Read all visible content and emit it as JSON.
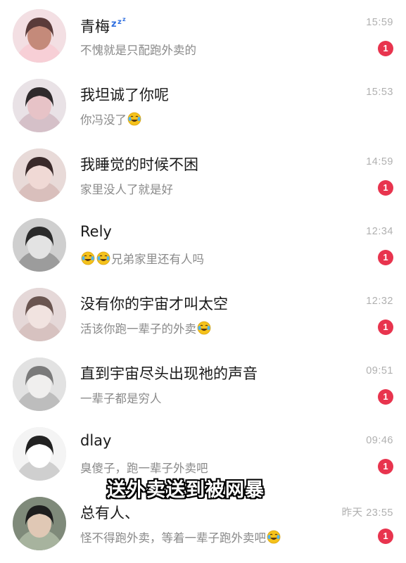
{
  "chats": [
    {
      "name": "青梅",
      "name_suffix_icon": "sleeping-zzz-icon",
      "preview": "不愧就是只配跑外卖的",
      "preview_emoji_prefix": 0,
      "preview_emoji_suffix": 0,
      "time": "15:59",
      "badge": "1"
    },
    {
      "name": "我坦诚了你呢",
      "preview": "你冯没了",
      "preview_emoji_prefix": 0,
      "preview_emoji_suffix": 1,
      "time": "15:53",
      "badge": ""
    },
    {
      "name": "我睡觉的时候不困",
      "preview": "家里没人了就是好",
      "preview_emoji_prefix": 0,
      "preview_emoji_suffix": 0,
      "time": "14:59",
      "badge": "1"
    },
    {
      "name": "Rely",
      "preview": "兄弟家里还有人吗",
      "preview_emoji_prefix": 2,
      "preview_emoji_suffix": 0,
      "time": "12:34",
      "badge": "1"
    },
    {
      "name": "没有你的宇宙才叫太空",
      "preview": "活该你跑一辈子的外卖",
      "preview_emoji_prefix": 0,
      "preview_emoji_suffix": 1,
      "time": "12:32",
      "badge": "1"
    },
    {
      "name": "直到宇宙尽头出现祂的声音",
      "preview": "一辈子都是穷人",
      "preview_emoji_prefix": 0,
      "preview_emoji_suffix": 0,
      "time": "09:51",
      "badge": "1"
    },
    {
      "name": "dlay",
      "preview": "臭傻子，跑一辈子外卖吧",
      "preview_emoji_prefix": 0,
      "preview_emoji_suffix": 0,
      "time": "09:46",
      "badge": "1"
    },
    {
      "name": "总有人、",
      "preview": "怪不得跑外卖，等着一辈子跑外卖吧",
      "preview_emoji_prefix": 0,
      "preview_emoji_suffix": 1,
      "time": "昨天 23:55",
      "badge": "1"
    }
  ],
  "caption": "送外卖送到被网暴",
  "colors": {
    "badge": "#e8344e",
    "time": "#b0b0b0",
    "preview": "#8a8a8a",
    "name": "#1a1a1a",
    "emoji": "#f5c21b"
  },
  "icons": {
    "emoji": "tears-of-joy-emoji-icon"
  }
}
